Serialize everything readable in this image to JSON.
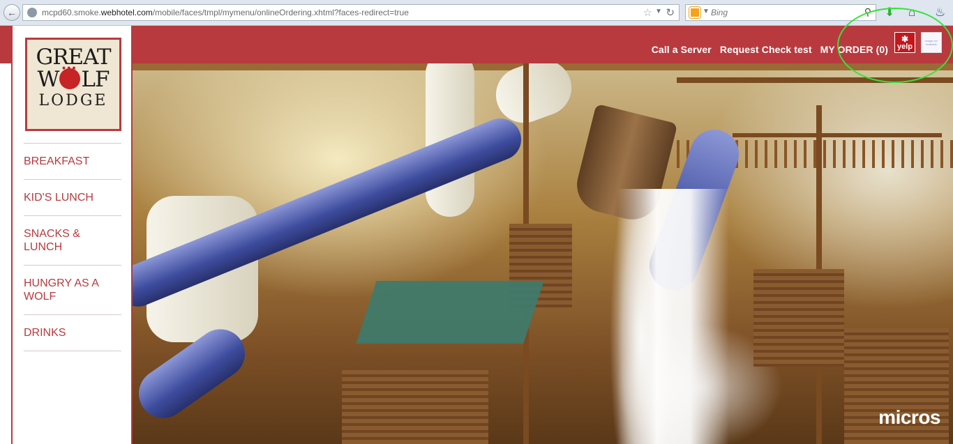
{
  "browser": {
    "url_prefix": "mcpd60.smoke.",
    "url_domain": "webhotel.com",
    "url_path": "/mobile/faces/tmpl/mymenu/onlineOrdering.xhtml?faces-redirect=true",
    "search_placeholder": "Bing"
  },
  "header": {
    "call_server": "Call a Server",
    "request_check": "Request Check test",
    "my_order": "MY ORDER (0)",
    "yelp_label": "yelp",
    "thumb_label": "image not available"
  },
  "logo": {
    "line1": "GREAT",
    "line2_left": "W",
    "line2_right": "LF",
    "line3": "LODGE"
  },
  "menu": {
    "items": [
      {
        "label": "BREAKFAST"
      },
      {
        "label": "KID'S LUNCH"
      },
      {
        "label": "SNACKS & LUNCH"
      },
      {
        "label": "HUNGRY AS A WOLF"
      },
      {
        "label": "DRINKS"
      }
    ]
  },
  "hero": {
    "brand": "micros"
  },
  "colors": {
    "brand_red": "#b83a3f",
    "highlight_green": "#37e23a"
  }
}
